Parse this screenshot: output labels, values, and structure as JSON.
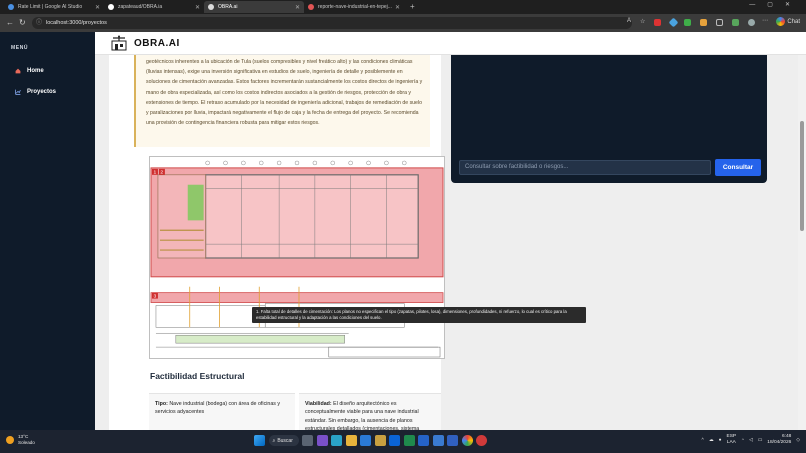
{
  "browser": {
    "tabs": [
      {
        "label": "Rate Limit | Google AI Studio",
        "active": false,
        "fav_color": "#4a90e2"
      },
      {
        "label": "zapateaud/OBRA.ia",
        "active": false,
        "fav_color": "#ffffff"
      },
      {
        "label": "OBRA.ai",
        "active": true,
        "fav_color": "#dcdcdc"
      },
      {
        "label": "reporte-nave-industrial-en-tepej...",
        "active": false,
        "fav_color": "#e25555"
      }
    ],
    "new_tab": "+",
    "url": "localhost:3000/proyectos",
    "chat_label": "Chat"
  },
  "sidebar": {
    "menu_label": "MENÚ",
    "items": [
      {
        "label": "Home"
      },
      {
        "label": "Proyectos"
      }
    ]
  },
  "header": {
    "brand": "OBRA.AI"
  },
  "risk_note": {
    "text": "geotécnicos inherentes a la ubicación de Tula (suelos compresibles y nivel freático alto) y las condiciones climáticas (lluvias intensas), exige una inversión significativa en estudios de suelo, ingeniería de detalle y posiblemente en soluciones de cimentación avanzadas. Estos factores incrementarán sustancialmente los costos directos de ingeniería y mano de obra especializada, así como los costos indirectos asociados a la gestión de riesgos, protección de obra y extensiones de tiempo. El retraso acumulado por la necesidad de ingeniería adicional, trabajos de remediación de suelo y paralizaciones por lluvia, impactará negativamente el flujo de caja y la fecha de entrega del proyecto. Se recomienda una provisión de contingencia financiera robusta para mitigar estos riesgos."
  },
  "plan": {
    "markers": [
      "1",
      "2",
      "3"
    ],
    "tooltip": "1. Falta total de detalles de cimentación: Los planos no especifican el tipo (zapatas, pilotes, losa), dimensiones, profundidades, ni refuerzo, lo cual es crítico para la estabilidad estructural y la adaptación a las condiciones del suelo."
  },
  "factibilidad": {
    "title": "Factibilidad Estructural",
    "tipo_label": "Tipo:",
    "tipo_text": "Nave industrial (bodega) con área de oficinas y servicios adyacentes",
    "viabilidad_label": "Viabilidad:",
    "viabilidad_text": "El diseño arquitectónico es conceptualmente viable para una nave industrial estándar. Sin embargo, la ausencia de planos estructurales detallados (cimentaciones, sistema"
  },
  "consult": {
    "placeholder": "Consultar sobre factibilidad o riesgos...",
    "button": "Consultar"
  },
  "taskbar": {
    "temp": "13°C",
    "weather": "Soleado",
    "search": "Buscar",
    "lang_top": "ESP",
    "lang_bottom": "LAA",
    "time": "6:48",
    "date": "18/04/2026"
  },
  "colors": {
    "sidebar_bg": "#0f1b2a",
    "accent_blue": "#2563eb",
    "plan_red": "#e88f95"
  }
}
